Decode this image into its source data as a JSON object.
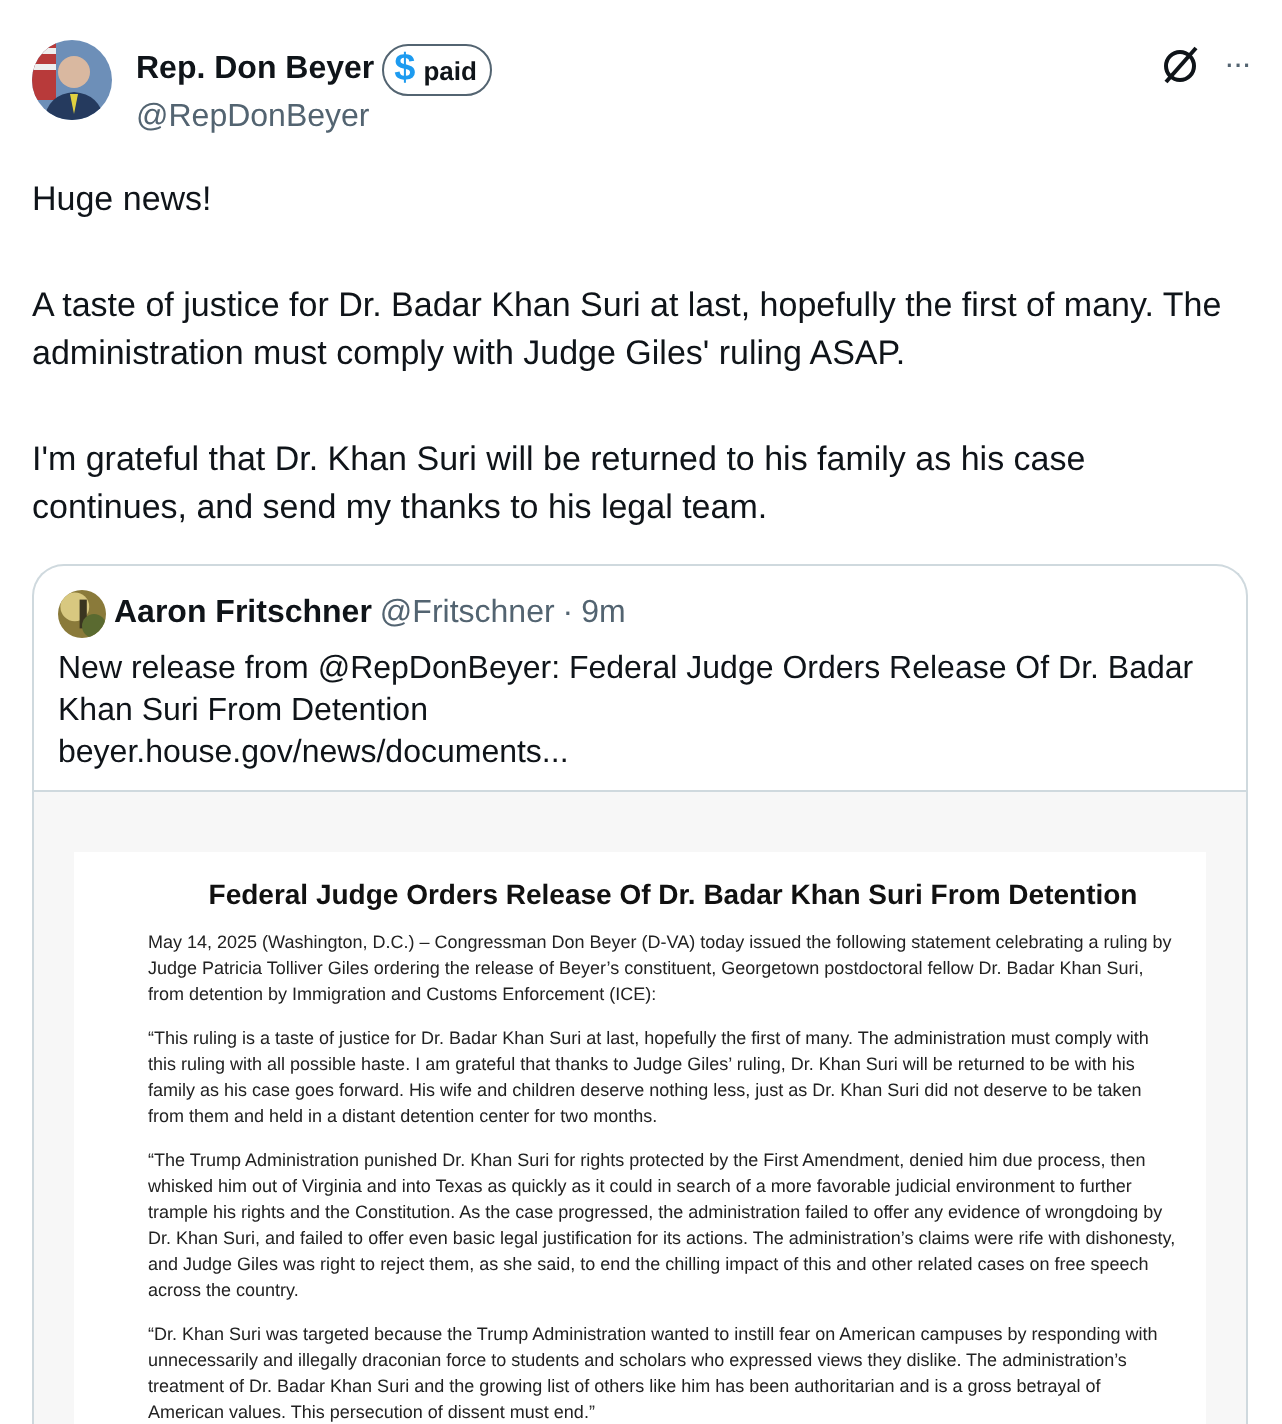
{
  "post": {
    "author": "Rep. Don Beyer",
    "badge": {
      "symbol": "$",
      "label": "paid"
    },
    "handle": "@RepDonBeyer",
    "more": "···",
    "paragraphs": [
      "Huge news!",
      "A taste of justice for Dr. Badar Khan Suri at last, hopefully the first of many. The administration must comply with Judge Giles' ruling ASAP.",
      "I'm grateful that Dr. Khan Suri will be returned to his family as his case continues, and send my thanks to his legal team."
    ]
  },
  "quote": {
    "author": "Aaron Fritschner",
    "handle": "@Fritschner",
    "separator": "·",
    "time": "9m",
    "text": "New release from @RepDonBeyer: Federal Judge Orders Release Of Dr. Badar Khan Suri From Detention",
    "link": "beyer.house.gov/news/documents...",
    "document": {
      "title": "Federal Judge Orders Release Of Dr. Badar Khan Suri From Detention",
      "paragraphs": [
        "May 14, 2025 (Washington, D.C.) – Congressman Don Beyer (D-VA) today issued the following statement celebrating a ruling by Judge Patricia Tolliver Giles ordering the release of Beyer’s constituent, Georgetown postdoctoral fellow Dr. Badar Khan Suri, from detention by Immigration and Customs Enforcement (ICE):",
        "“This ruling is a taste of justice for Dr. Badar Khan Suri at last, hopefully the first of many. The administration must comply with this ruling with all possible haste. I am grateful that thanks to Judge Giles’ ruling, Dr. Khan Suri will be returned to be with his family as his case goes forward. His wife and children deserve nothing less, just as Dr. Khan Suri did not deserve to be taken from them and held in a distant detention center for two months.",
        "“The Trump Administration punished Dr. Khan Suri for rights protected by the First Amendment, denied him due process, then whisked him out of Virginia and into Texas as quickly as it could in search of a more favorable judicial environment to further trample his rights and the Constitution. As the case progressed, the administration failed to offer any evidence of wrongdoing by Dr. Khan Suri, and failed to offer even basic legal justification for its actions. The administration’s claims were rife with dishonesty, and Judge Giles was right to reject them, as she said, to end the chilling impact of this and other related cases on free speech across the country.",
        "“Dr. Khan Suri was targeted because the Trump Administration wanted to instill fear on American campuses by responding with unnecessarily and illegally draconian force to students and scholars who expressed views they dislike. The administration’s treatment of Dr. Badar Khan Suri and the growing list of others like him has been authoritarian and is a gross betrayal of American values. This persecution of dissent must end.”"
      ]
    }
  }
}
